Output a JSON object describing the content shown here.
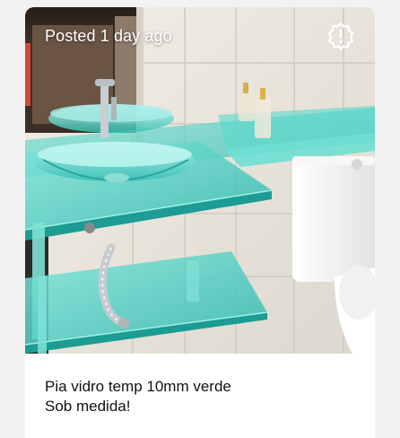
{
  "listing": {
    "posted_text": "Posted 1 day ago",
    "report_icon": "alert-badge-icon",
    "description_lines": [
      "Pia vidro temp 10mm verde",
      "Sob medida!"
    ]
  },
  "colors": {
    "glass": "#3fd0c4",
    "wall_tile": "#eae6dc",
    "card_bg": "#ffffff",
    "page_bg": "#f2f2f2"
  }
}
